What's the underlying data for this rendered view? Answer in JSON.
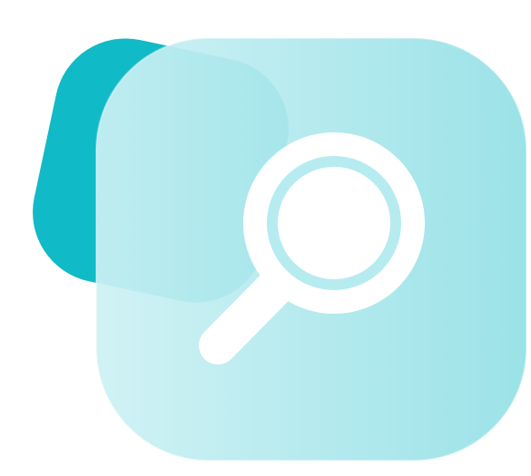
{
  "illustration": {
    "icon": "search-icon",
    "colors": {
      "back_tile": "#10BAC6",
      "front_tile_light": "#CDF1F4",
      "front_tile_dark": "#92E0E6",
      "magnifier_body": "#FFFFFF",
      "magnifier_ring": "#B6ECF0"
    }
  }
}
